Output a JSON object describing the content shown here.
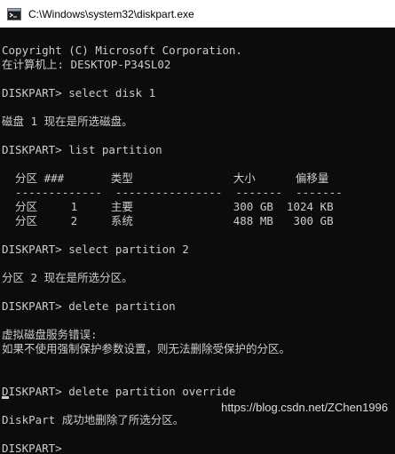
{
  "window": {
    "title": "C:\\Windows\\system32\\diskpart.exe",
    "icon": "console-icon"
  },
  "console": {
    "lines": [
      "Copyright (C) Microsoft Corporation.",
      "在计算机上: DESKTOP-P34SL02",
      "",
      "DISKPART> select disk 1",
      "",
      "磁盘 1 现在是所选磁盘。",
      "",
      "DISKPART> list partition",
      "",
      "  分区 ###       类型               大小      偏移量",
      "  -------------  ----------------  -------  -------",
      "  分区     1     主要               300 GB  1024 KB",
      "  分区     2     系统               488 MB   300 GB",
      "",
      "DISKPART> select partition 2",
      "",
      "分区 2 现在是所选分区。",
      "",
      "DISKPART> delete partition",
      "",
      "虚拟磁盘服务错误:",
      "如果不使用强制保护参数设置，则无法删除受保护的分区。",
      "",
      "",
      "DISKPART> delete partition override",
      "",
      "DiskPart 成功地删除了所选分区。",
      "",
      "DISKPART>"
    ]
  },
  "watermark": "https://blog.csdn.net/ZChen1996"
}
